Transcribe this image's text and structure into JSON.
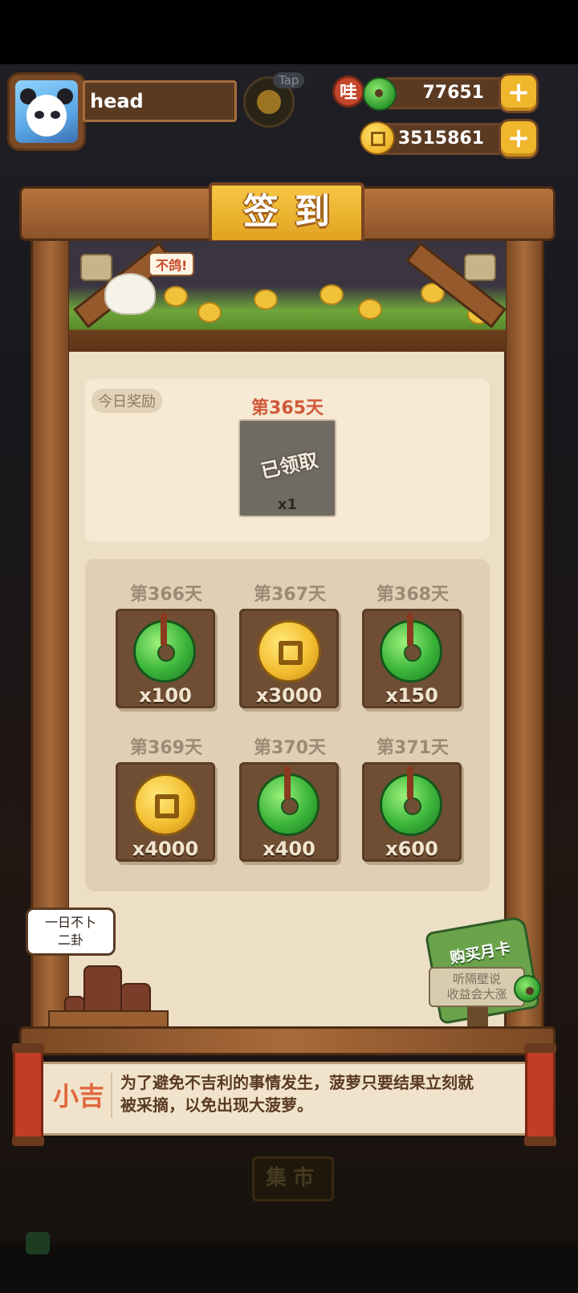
{
  "player": {
    "name": "head"
  },
  "tap_label": "Tap",
  "resources": {
    "wa_badge": "哇",
    "jade": "77651",
    "coins": "3515861",
    "plus": "+"
  },
  "panel": {
    "title": "签到",
    "bubble": "不鸽!",
    "today": {
      "tag": "今日奖励",
      "day": "第365天",
      "status": "已领取",
      "quantity": "x1"
    },
    "rewards": [
      {
        "day": "第366天",
        "type": "jade",
        "icon": "jade-icon",
        "quantity": "x100"
      },
      {
        "day": "第367天",
        "type": "coin",
        "icon": "coin-icon",
        "quantity": "x3000"
      },
      {
        "day": "第368天",
        "type": "jade",
        "icon": "jade-icon",
        "quantity": "x150"
      },
      {
        "day": "第369天",
        "type": "coin",
        "icon": "coin-icon",
        "quantity": "x4000"
      },
      {
        "day": "第370天",
        "type": "jade",
        "icon": "jade-icon",
        "quantity": "x400"
      },
      {
        "day": "第371天",
        "type": "jade",
        "icon": "jade-icon",
        "quantity": "x600"
      }
    ],
    "speech": {
      "line1": "一日不卜",
      "line2": "二卦"
    },
    "month_card": {
      "title": "购买月卡",
      "line1": "听隔壁说",
      "line2": "收益会大涨"
    }
  },
  "dialog": {
    "speaker": "小吉",
    "line1": "为了避免不吉利的事情发生，菠萝只要结果立刻就",
    "line2": "被采摘，以免出现大菠萝。"
  },
  "background": {
    "market_sign": "集市"
  },
  "colors": {
    "title_gold": "#f6c743",
    "wood": "#8d5328",
    "paper": "#ecdfc6",
    "day_red": "#d1583a",
    "speaker_orange": "#e0683e"
  }
}
